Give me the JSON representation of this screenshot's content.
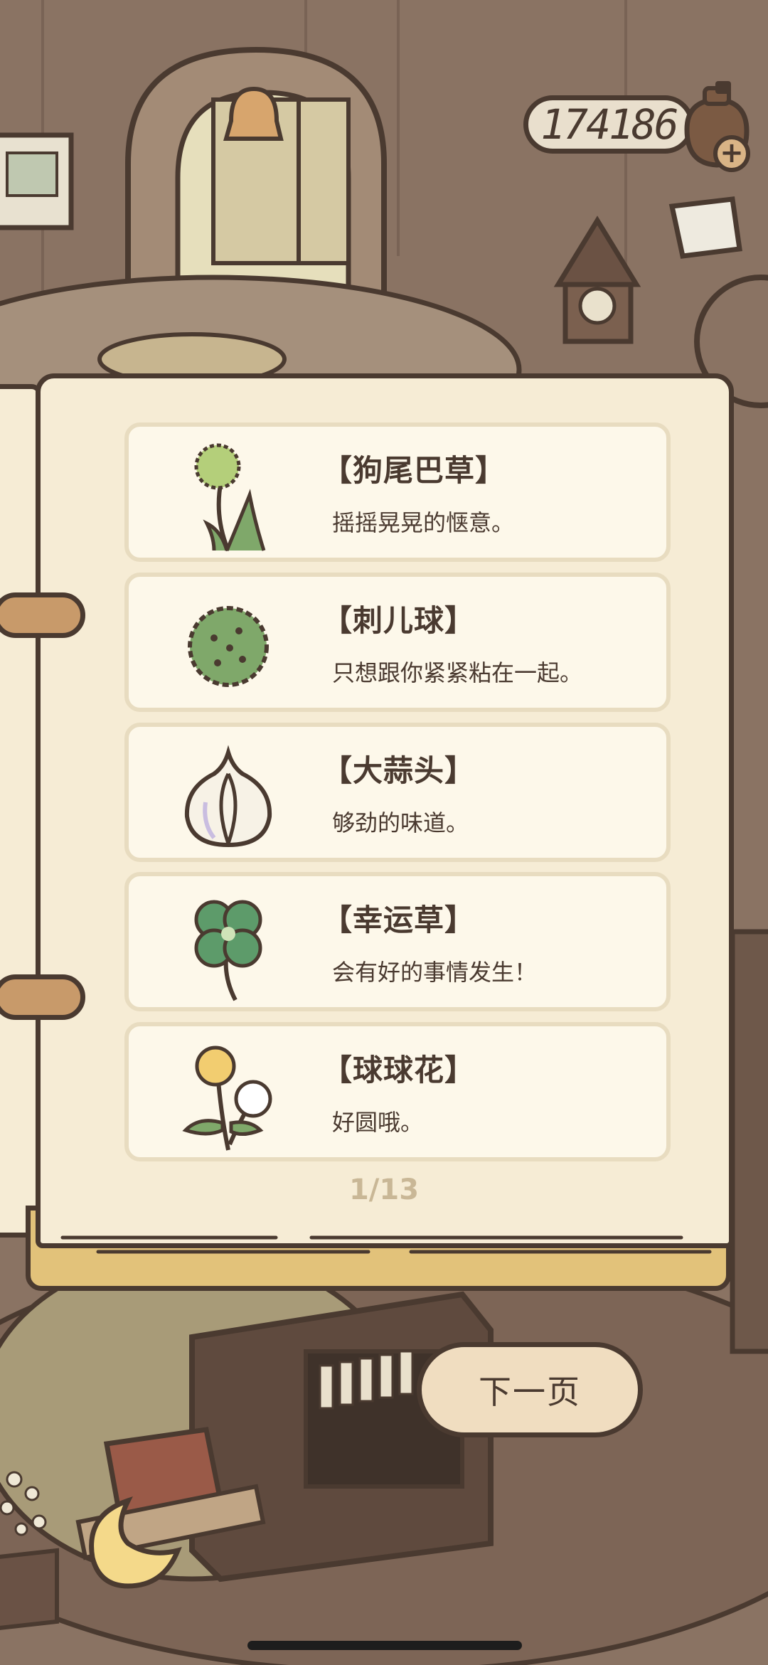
{
  "currency": {
    "coins": "174186",
    "add_label": "+"
  },
  "book": {
    "items": [
      {
        "name": "【狗尾巴草】",
        "desc": "摇摇晃晃的惬意。",
        "icon": "foxtail-grass-icon"
      },
      {
        "name": "【刺儿球】",
        "desc": "只想跟你紧紧粘在一起。",
        "icon": "burr-ball-icon"
      },
      {
        "name": "【大蒜头】",
        "desc": "够劲的味道。",
        "icon": "garlic-icon"
      },
      {
        "name": "【幸运草】",
        "desc": "会有好的事情发生！",
        "icon": "four-leaf-clover-icon"
      },
      {
        "name": "【球球花】",
        "desc": "好圆哦。",
        "icon": "pompom-flower-icon"
      }
    ],
    "page_indicator": "1/13"
  },
  "actions": {
    "next_page": "下一页"
  },
  "colors": {
    "outline": "#4a3a30",
    "page": "#f6ecd5",
    "card": "#fdf8ea",
    "accent": "#e2c27a"
  }
}
